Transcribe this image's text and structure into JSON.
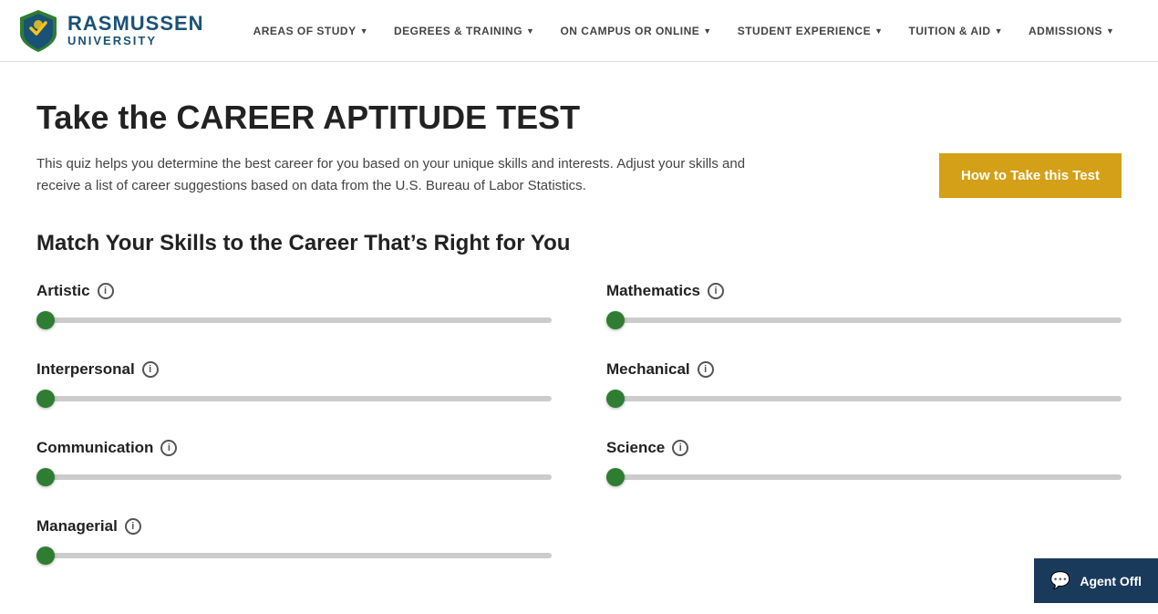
{
  "nav": {
    "logo": {
      "rasmussen": "RASMUSSEN",
      "university": "UNIVERSITY"
    },
    "items": [
      {
        "id": "areas-of-study",
        "label": "AREAS OF STUDY",
        "hasDropdown": true
      },
      {
        "id": "degrees-training",
        "label": "DEGREES & TRAINING",
        "hasDropdown": true
      },
      {
        "id": "on-campus-online",
        "label": "ON CAMPUS OR ONLINE",
        "hasDropdown": true
      },
      {
        "id": "student-experience",
        "label": "STUDENT EXPERIENCE",
        "hasDropdown": true
      },
      {
        "id": "tuition-aid",
        "label": "TUITION & AID",
        "hasDropdown": true
      },
      {
        "id": "admissions",
        "label": "ADMISSIONS",
        "hasDropdown": true
      }
    ]
  },
  "page": {
    "title_prefix": "Take the ",
    "title_bold": "CAREER APTITUDE TEST",
    "intro_text": "This quiz helps you determine the best career for you based on your unique skills and interests. Adjust your skills and receive a list of career suggestions based on data from the U.S. Bureau of Labor Statistics.",
    "how_to_btn": "How to Take this Test",
    "section_title": "Match Your Skills to the Career That’s Right for You"
  },
  "sliders": [
    {
      "id": "artistic",
      "label": "Artistic",
      "value": 0
    },
    {
      "id": "mathematics",
      "label": "Mathematics",
      "value": 0
    },
    {
      "id": "interpersonal",
      "label": "Interpersonal",
      "value": 0
    },
    {
      "id": "mechanical",
      "label": "Mechanical",
      "value": 0
    },
    {
      "id": "communication",
      "label": "Communication",
      "value": 0
    },
    {
      "id": "science",
      "label": "Science",
      "value": 0
    },
    {
      "id": "managerial",
      "label": "Managerial",
      "value": 0
    }
  ],
  "chat": {
    "label": "Agent Offl"
  }
}
